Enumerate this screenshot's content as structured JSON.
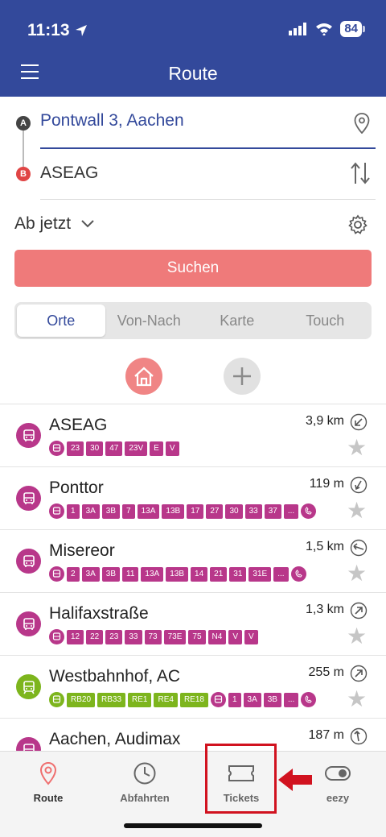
{
  "status_bar": {
    "time": "11:13",
    "battery": "84"
  },
  "header": {
    "title": "Route"
  },
  "route": {
    "pin_a": "A",
    "pin_b": "B",
    "from": "Pontwall 3, Aachen",
    "to": "ASEAG",
    "time_option": "Ab jetzt",
    "search_label": "Suchen"
  },
  "segments": [
    "Orte",
    "Von-Nach",
    "Karte",
    "Touch"
  ],
  "stops": [
    {
      "name": "ASEAG",
      "distance": "3,9 km",
      "icon_color": "#b8378a",
      "lines": [
        [
          "23",
          "30",
          "47",
          "23V",
          "E",
          "V"
        ]
      ]
    },
    {
      "name": "Ponttor",
      "distance": "119 m",
      "icon_color": "#b8378a",
      "lines": [
        [
          "1",
          "3A",
          "3B",
          "7",
          "13A",
          "13B",
          "17",
          "27",
          "30",
          "33",
          "37",
          "..."
        ]
      ]
    },
    {
      "name": "Misereor",
      "distance": "1,5 km",
      "icon_color": "#b8378a",
      "lines": [
        [
          "2",
          "3A",
          "3B",
          "11",
          "13A",
          "13B",
          "14",
          "21",
          "31",
          "31E",
          "..."
        ]
      ]
    },
    {
      "name": "Halifaxstraße",
      "distance": "1,3 km",
      "icon_color": "#b8378a",
      "lines": [
        [
          "12",
          "22",
          "23",
          "33",
          "73",
          "73E",
          "75",
          "N4",
          "V",
          "V"
        ]
      ]
    },
    {
      "name": "Westbahnhof, AC",
      "distance": "255 m",
      "icon_color": "#7db51d",
      "rail_lines": [
        "RB20",
        "RB33",
        "RE1",
        "RE4",
        "RE18"
      ],
      "lines": [
        [
          "1",
          "3A",
          "3B",
          "..."
        ]
      ]
    },
    {
      "name": "Aachen, Audimax",
      "distance": "187 m",
      "icon_color": "#b8378a"
    }
  ],
  "tabs": {
    "route": "Route",
    "abfahrten": "Abfahrten",
    "tickets": "Tickets",
    "eezy": "eezy"
  },
  "colors": {
    "brand": "#33499b",
    "bus": "#b8378a",
    "rail": "#7db51d",
    "search": "#ef7a7a",
    "annotation": "#d1121f"
  }
}
